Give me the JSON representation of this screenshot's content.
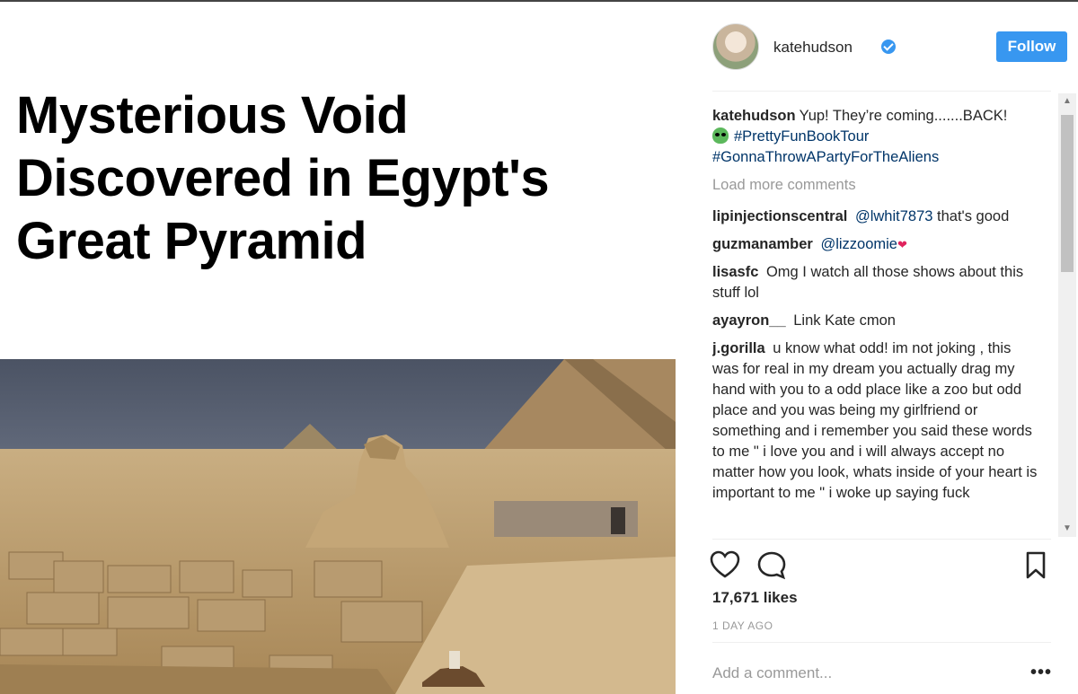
{
  "post": {
    "headline": "Mysterious Void Discovered in Egypt's Great Pyramid"
  },
  "header": {
    "username": "katehudson",
    "follow_label": "Follow"
  },
  "caption": {
    "user": "katehudson",
    "text": "Yup! They’re coming.......BACK!",
    "hashtags": [
      "#PrettyFunBookTour",
      "#GonnaThrowAPartyForTheAliens"
    ]
  },
  "load_more": "Load more comments",
  "comments": [
    {
      "user": "lipinjectionscentral",
      "mention": "@lwhit7873",
      "text": "that's good"
    },
    {
      "user": "guzmanamber",
      "mention": "@lizzoomie",
      "text": ""
    },
    {
      "user": "lisasfc",
      "mention": "",
      "text": "Omg I watch all those shows about this stuff lol"
    },
    {
      "user": "ayayron__",
      "mention": "",
      "text": "Link Kate cmon"
    },
    {
      "user": "j.gorilla",
      "mention": "",
      "text": "u know what odd! im not joking , this was for real in my dream you actually drag my hand with you to a odd place like a zoo but odd place and you was being my girlfriend or something and i remember you said these words to me \" i love you and i will always accept no matter how you look, whats inside of your heart is important to me \" i woke up saying fuck"
    }
  ],
  "likes": "17,671 likes",
  "timestamp": "1 DAY AGO",
  "add_comment_placeholder": "Add a comment...",
  "more_options": "•••",
  "icons": [
    "heart-icon",
    "comment-icon",
    "bookmark-icon",
    "verified-icon",
    "alien-emoji-icon"
  ],
  "colors": {
    "accent": "#3897f0",
    "link": "#003569",
    "muted": "#999999"
  }
}
